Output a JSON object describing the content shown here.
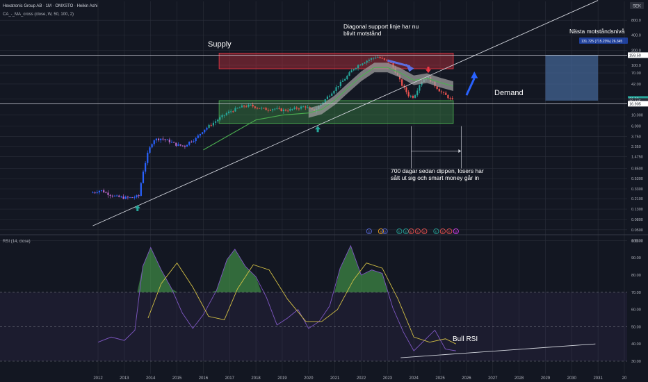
{
  "header": {
    "symbol_line": "Hexatronic Group AB · 1M · OMXSTO · Heikin Ashi",
    "indicator_line": "CA_-_MA_cross (close, W, 50, 100, 2)",
    "currency": "SEK"
  },
  "rsi_panel": {
    "label": "RSI (14, close)"
  },
  "annotations": {
    "supply": "Supply",
    "demand": "Demand",
    "diagonal_line1": "Diagonal support linje har nu",
    "diagonal_line2": "blivit motstånd",
    "next_resistance": "Nästa motståndsnivå",
    "measure_box": "131.725 (715.23%) 26.345",
    "dip_line1": "700 dagar sedan dippen, losers har",
    "dip_line2": "sålt ut sig och smart money går in",
    "bull_rsi": "Bull RSI"
  },
  "price_tags": [
    {
      "label": "159.50",
      "value": 159.5,
      "color": "#ffffff",
      "text_color": "#131722"
    },
    {
      "label": "21.09",
      "value": 21.09,
      "color": "#26a69a",
      "text_color": "#ffffff"
    },
    {
      "label": "19.145",
      "value": 19.145,
      "color": "#2a2e39",
      "text_color": "#d1d4dc"
    },
    {
      "label": "16.905",
      "value": 16.905,
      "color": "#ffffff",
      "text_color": "#131722"
    }
  ],
  "event_markers": [
    {
      "label": "D",
      "color": "#5b6ee1"
    },
    {
      "label": "S",
      "color": "#f5a623"
    },
    {
      "label": "D",
      "color": "#5b6ee1"
    },
    {
      "label": "E",
      "color": "#26a69a"
    },
    {
      "label": "E",
      "color": "#26a69a"
    },
    {
      "label": "E",
      "color": "#ef5350"
    },
    {
      "label": "E",
      "color": "#ef5350"
    },
    {
      "label": "E",
      "color": "#ef5350"
    },
    {
      "label": "E",
      "color": "#26a69a"
    },
    {
      "label": "E",
      "color": "#ef5350"
    },
    {
      "label": "E",
      "color": "#ef5350"
    },
    {
      "label": "D",
      "color": "#e040fb"
    }
  ],
  "colors": {
    "background": "#131722",
    "up": "#26a69a",
    "down": "#ef5350",
    "volatile_blue": "#2962ff",
    "volatile_purple": "#ba68c8",
    "supply_zone": "#f23645",
    "demand_zone": "#4caf50",
    "ma_fast": "#4caf50",
    "rsi_line": "#7e57c2",
    "rsi_ma": "#d4c045"
  },
  "chart_data": [
    {
      "type": "line",
      "title": "",
      "scale": "log",
      "x_axis": {
        "ticks": [
          "2012",
          "2013",
          "2014",
          "2015",
          "2016",
          "2017",
          "2018",
          "2019",
          "2020",
          "2021",
          "2022",
          "2023",
          "2024",
          "2025",
          "2026",
          "2027",
          "2028",
          "2029",
          "2030",
          "2031",
          "20"
        ]
      },
      "y_axis": {
        "ticks": [
          "800.0",
          "400.0",
          "200.0",
          "100.0",
          "70.00",
          "42.00",
          "21.00",
          "10.000",
          "6.000",
          "3.750",
          "2.350",
          "1.4750",
          "0.8500",
          "0.5300",
          "0.3300",
          "0.2100",
          "0.1300",
          "0.0800",
          "0.0500",
          "0.0300"
        ],
        "tick_values": [
          800,
          400,
          200,
          100,
          70,
          42,
          21,
          10,
          6,
          3.75,
          2.35,
          1.475,
          0.85,
          0.53,
          0.33,
          0.21,
          0.13,
          0.08,
          0.05,
          0.03
        ],
        "range": [
          0.025,
          1700
        ]
      },
      "series": [
        {
          "style": "heikin-ashi candles (monthly)",
          "x": [
            2011.8,
            2012.1,
            2012.4,
            2012.7,
            2013.0,
            2013.3,
            2013.55,
            2013.7,
            2013.9,
            2014.1,
            2014.4,
            2014.7,
            2015.0,
            2015.3,
            2015.5,
            2015.7,
            2016.0,
            2016.3,
            2016.6,
            2016.9,
            2017.2,
            2017.5,
            2017.8,
            2018.1,
            2018.4,
            2018.7,
            2019.0,
            2019.3,
            2019.6,
            2019.9,
            2020.0,
            2020.2,
            2020.5,
            2020.8,
            2021.1,
            2021.4,
            2021.7,
            2022.0,
            2022.3,
            2022.6,
            2022.9,
            2023.1,
            2023.3,
            2023.55,
            2023.8,
            2024.0,
            2024.25,
            2024.5,
            2024.75,
            2025.0,
            2025.25,
            2025.5
          ],
          "y": [
            0.28,
            0.31,
            0.26,
            0.23,
            0.22,
            0.22,
            0.24,
            0.7,
            1.8,
            3.2,
            3.4,
            3.0,
            2.5,
            2.4,
            3.0,
            3.3,
            5.0,
            6.5,
            8.5,
            11.0,
            13.0,
            15.0,
            15.5,
            14.0,
            13.0,
            13.5,
            12.5,
            12.8,
            14.0,
            15.0,
            13.5,
            12.0,
            17.0,
            26.0,
            38.0,
            55.0,
            85.0,
            110.0,
            130.0,
            150.0,
            125.0,
            115.0,
            75.0,
            40.0,
            25.0,
            23.0,
            45.0,
            60.0,
            42.0,
            30.0,
            24.0,
            19.0
          ]
        },
        {
          "name": "",
          "style": "MA 50 (weekly)",
          "x": [
            2016.0,
            2017.0,
            2018.0,
            2019.0,
            2020.0,
            2020.5,
            2021.0,
            2021.5,
            2022.0,
            2022.5,
            2023.0,
            2023.5,
            2024.0,
            2024.5,
            2025.0,
            2025.5
          ],
          "y": [
            2.0,
            4.0,
            8.0,
            10.0,
            11.0,
            13.0,
            20.0,
            35.0,
            60.0,
            90.0,
            90.0,
            70.0,
            50.0,
            55.0,
            45.0,
            38.0
          ]
        }
      ],
      "annotations": [
        {
          "type": "zone",
          "label": "Supply",
          "x_range": [
            2016.6,
            2025.5
          ],
          "y_range": [
            85,
            175
          ]
        },
        {
          "type": "zone",
          "label": "Demand",
          "x_range": [
            2016.6,
            2025.5
          ],
          "y_range": [
            6.8,
            19.5
          ]
        },
        {
          "type": "trendline",
          "label": "Diagonal support",
          "from": {
            "x": 2011.8,
            "y": 0.06
          },
          "to": {
            "x": 2031.0,
            "y": 2000
          }
        },
        {
          "type": "horizontal_line",
          "y": 159.5
        },
        {
          "type": "horizontal_line",
          "y": 16.905
        }
      ],
      "grid": true
    },
    {
      "type": "line",
      "title": "RSI (14, close)",
      "y_axis": {
        "ticks": [
          "100.00",
          "90.00",
          "80.00",
          "70.00",
          "60.00",
          "50.00",
          "40.00",
          "30.00"
        ],
        "range": [
          30,
          100
        ]
      },
      "series": [
        {
          "name": "RSI",
          "x": [
            2012.0,
            2012.5,
            2013.0,
            2013.4,
            2013.7,
            2014.0,
            2014.4,
            2014.8,
            2015.2,
            2015.6,
            2016.0,
            2016.5,
            2016.9,
            2017.2,
            2017.6,
            2018.0,
            2018.4,
            2018.8,
            2019.2,
            2019.6,
            2020.0,
            2020.4,
            2020.8,
            2021.2,
            2021.6,
            2022.0,
            2022.4,
            2022.8,
            2023.2,
            2023.6,
            2024.0,
            2024.4,
            2024.8,
            2025.2,
            2025.6
          ],
          "y": [
            41,
            44,
            42,
            48,
            85,
            96,
            83,
            72,
            58,
            49,
            57,
            71,
            89,
            95,
            85,
            79,
            67,
            51,
            55,
            60,
            49,
            53,
            62,
            84,
            97,
            80,
            83,
            81,
            61,
            47,
            36,
            42,
            48,
            37,
            36
          ]
        },
        {
          "name": "RSI-based MA",
          "x": [
            2013.9,
            2014.4,
            2015.0,
            2015.6,
            2016.2,
            2016.8,
            2017.3,
            2017.9,
            2018.5,
            2019.2,
            2019.9,
            2020.5,
            2021.1,
            2021.7,
            2022.2,
            2022.8,
            2023.4,
            2024.0,
            2024.6,
            2025.2,
            2025.6
          ],
          "y": [
            55,
            75,
            87,
            73,
            56,
            54,
            72,
            86,
            83,
            66,
            53,
            53,
            60,
            77,
            87,
            84,
            66,
            44,
            41,
            43,
            40
          ]
        }
      ],
      "annotations": [
        {
          "type": "trendline",
          "label": "Bull RSI",
          "from": {
            "x": 2023.5,
            "y": 32
          },
          "to": {
            "x": 2030.9,
            "y": 40
          }
        }
      ],
      "grid": true
    }
  ]
}
